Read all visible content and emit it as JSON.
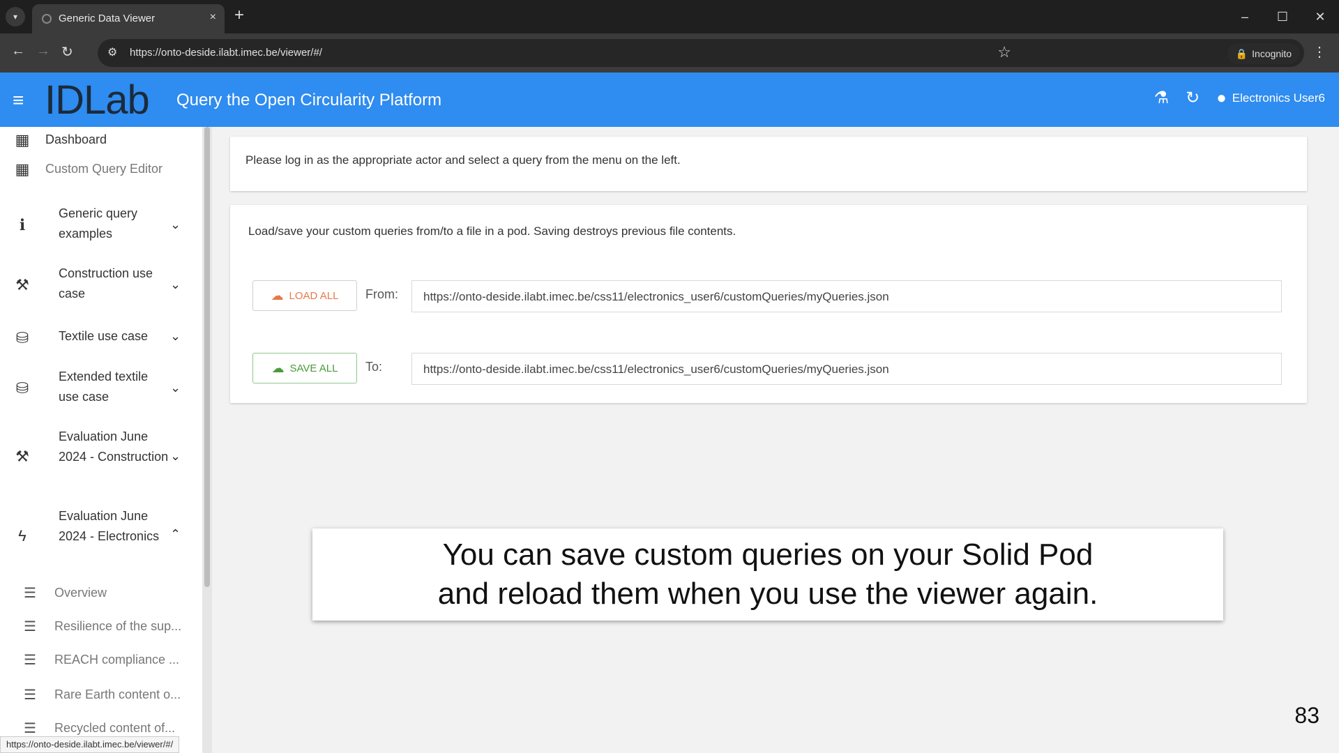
{
  "browser": {
    "tab_title": "Generic Data Viewer",
    "tab_close": "×",
    "new_tab": "+",
    "url": "https://onto-deside.ilabt.imec.be/viewer/#/",
    "incognito_label": "Incognito",
    "window_buttons": [
      "–",
      "☐",
      "✕"
    ]
  },
  "header": {
    "logo": "IDLab",
    "logo_sub": "",
    "title": "Query the Open Circularity Platform",
    "user_label": "Electronics User6"
  },
  "sidebar": {
    "top_items": [
      {
        "label": "Dashboard",
        "icon": "dashboard-icon"
      },
      {
        "label": "Custom Query Editor",
        "icon": "dashboard-icon"
      }
    ],
    "groups": [
      {
        "label": "Generic query examples",
        "icon": "info-icon",
        "expanded": false
      },
      {
        "label": "Construction use case",
        "icon": "tools-icon",
        "expanded": false
      },
      {
        "label": "Textile use case",
        "icon": "hanger-icon",
        "expanded": false
      },
      {
        "label": "Extended textile use case",
        "icon": "hanger-icon",
        "expanded": false
      },
      {
        "label": "Evaluation June 2024 - Construction",
        "icon": "tools-icon",
        "expanded": false
      },
      {
        "label": "Evaluation June 2024 - Electronics",
        "icon": "bolt-icon",
        "expanded": true
      }
    ],
    "sub_items": [
      "Overview",
      "Resilience of the sup...",
      "REACH compliance ...",
      "Rare Earth content o...",
      "Recycled content of..."
    ]
  },
  "main": {
    "info_text": "Please log in as the appropriate actor and select a query from the menu on the left.",
    "loadsave_text": "Load/save your custom queries from/to a file in a pod. Saving destroys previous file contents.",
    "load_button": "LOAD ALL",
    "save_button": "SAVE ALL",
    "from_label": "From:",
    "to_label": "To:",
    "from_value": "https://onto-deside.ilabt.imec.be/css11/electronics_user6/customQueries/myQueries.json",
    "to_value": "https://onto-deside.ilabt.imec.be/css11/electronics_user6/customQueries/myQueries.json"
  },
  "caption": {
    "line1": "You can save custom queries on your Solid Pod",
    "line2": "and reload them when you use the viewer again."
  },
  "page_number": "83",
  "status_url": "https://onto-deside.ilabt.imec.be/viewer/#/",
  "colors": {
    "appbar": "#2f8cf0",
    "load_accent": "#e8784a",
    "save_accent": "#4a9a3a"
  }
}
